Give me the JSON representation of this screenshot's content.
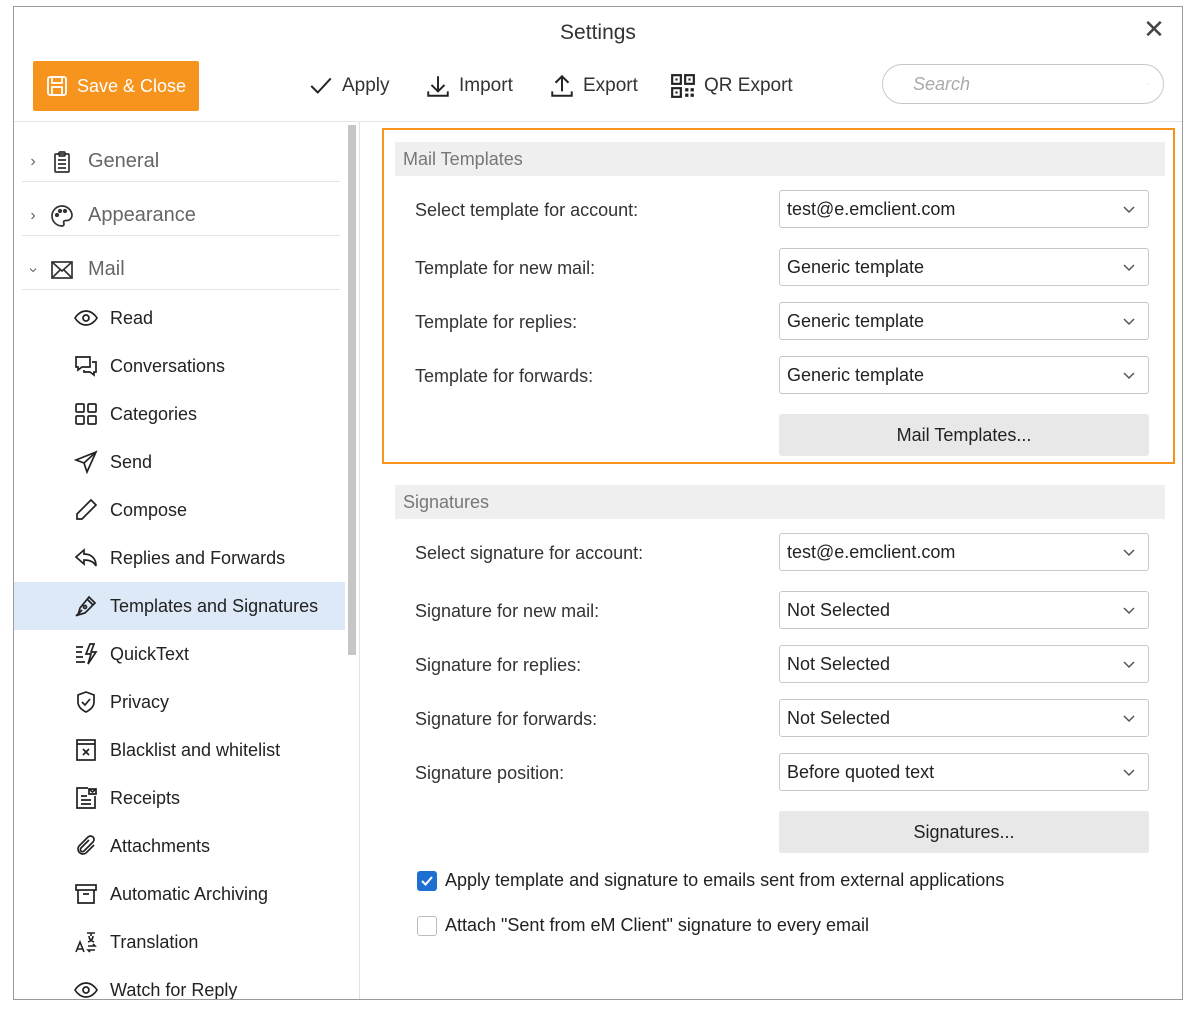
{
  "window": {
    "title": "Settings"
  },
  "toolbar": {
    "save_label": "Save & Close",
    "apply_label": "Apply",
    "import_label": "Import",
    "export_label": "Export",
    "qr_export_label": "QR Export",
    "search_placeholder": "Search"
  },
  "sidebar": {
    "sections": [
      {
        "label": "General",
        "icon": "clipboard-icon",
        "expanded": false
      },
      {
        "label": "Appearance",
        "icon": "palette-icon",
        "expanded": false
      },
      {
        "label": "Mail",
        "icon": "envelope-icon",
        "expanded": true
      }
    ],
    "items": [
      {
        "label": "Read",
        "icon": "eye-icon"
      },
      {
        "label": "Conversations",
        "icon": "chat-bubbles-icon"
      },
      {
        "label": "Categories",
        "icon": "grid-icon"
      },
      {
        "label": "Send",
        "icon": "paper-plane-icon"
      },
      {
        "label": "Compose",
        "icon": "pencil-icon"
      },
      {
        "label": "Replies and Forwards",
        "icon": "reply-icon"
      },
      {
        "label": "Templates and Signatures",
        "icon": "pen-nib-icon",
        "active": true
      },
      {
        "label": "QuickText",
        "icon": "quicktext-icon"
      },
      {
        "label": "Privacy",
        "icon": "shield-icon"
      },
      {
        "label": "Blacklist and whitelist",
        "icon": "blocked-box-icon"
      },
      {
        "label": "Receipts",
        "icon": "receipt-icon"
      },
      {
        "label": "Attachments",
        "icon": "paperclip-icon"
      },
      {
        "label": "Automatic Archiving",
        "icon": "archive-icon"
      },
      {
        "label": "Translation",
        "icon": "translate-icon"
      },
      {
        "label": "Watch for Reply",
        "icon": "eye-icon"
      }
    ]
  },
  "mail_templates": {
    "heading": "Mail Templates",
    "rows": [
      {
        "label": "Select template for account:",
        "value": "test@e.emclient.com"
      },
      {
        "label": "Template for new mail:",
        "value": "Generic template"
      },
      {
        "label": "Template for replies:",
        "value": "Generic template"
      },
      {
        "label": "Template for forwards:",
        "value": "Generic template"
      }
    ],
    "button_label": "Mail Templates..."
  },
  "signatures": {
    "heading": "Signatures",
    "rows": [
      {
        "label": "Select signature for account:",
        "value": "test@e.emclient.com"
      },
      {
        "label": "Signature for new mail:",
        "value": "Not Selected"
      },
      {
        "label": "Signature for replies:",
        "value": "Not Selected"
      },
      {
        "label": "Signature for forwards:",
        "value": "Not Selected"
      },
      {
        "label": "Signature position:",
        "value": "Before quoted text"
      }
    ],
    "button_label": "Signatures..."
  },
  "options": {
    "apply_external": {
      "label": "Apply template and signature to emails sent from external applications",
      "checked": true
    },
    "sent_from": {
      "label": "Attach \"Sent from eM Client\" signature to every email",
      "checked": false
    }
  },
  "colors": {
    "accent": "#f7941d",
    "selected": "#dde9f7",
    "checkbox": "#1f6fd1"
  }
}
